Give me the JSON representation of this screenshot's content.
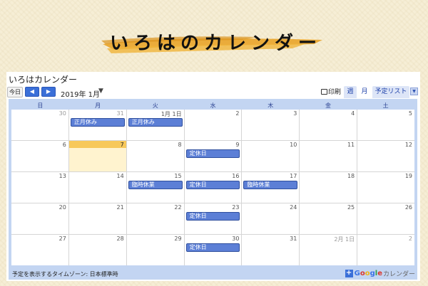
{
  "banner": {
    "title": "いろはのカレンダー"
  },
  "calendar": {
    "title": "いろはカレンダー",
    "toolbar": {
      "today": "今日",
      "prev": "◀",
      "next": "▶",
      "date_label": "2019年 1月",
      "print": "印刷",
      "tabs": [
        "週",
        "月",
        "予定リスト"
      ]
    },
    "days_of_week": [
      "日",
      "月",
      "火",
      "水",
      "木",
      "金",
      "土"
    ],
    "weeks": [
      [
        "30",
        "31",
        "1月 1日",
        "2",
        "3",
        "4",
        "5"
      ],
      [
        "6",
        "7",
        "8",
        "9",
        "10",
        "11",
        "12"
      ],
      [
        "13",
        "14",
        "15",
        "16",
        "17",
        "18",
        "19"
      ],
      [
        "20",
        "21",
        "22",
        "23",
        "24",
        "25",
        "26"
      ],
      [
        "27",
        "28",
        "29",
        "30",
        "31",
        "2月 1日",
        "2"
      ]
    ],
    "events": {
      "w0d1": "正月休み",
      "w0d2": "正月休み",
      "w1d3": "定休日",
      "w2d2": "臨時休業",
      "w2d3": "定休日",
      "w2d4": "臨時休業",
      "w3d3": "定休日",
      "w4d3": "定休日"
    },
    "footer": {
      "timezone": "予定を表示するタイムゾーン: 日本標準時",
      "plus": "+",
      "google": "Google",
      "suffix": "カレンダー"
    },
    "colors": {
      "event": "#5c7fd6",
      "today": "#f7c85a",
      "grid_header": "#c3d5f2"
    }
  }
}
